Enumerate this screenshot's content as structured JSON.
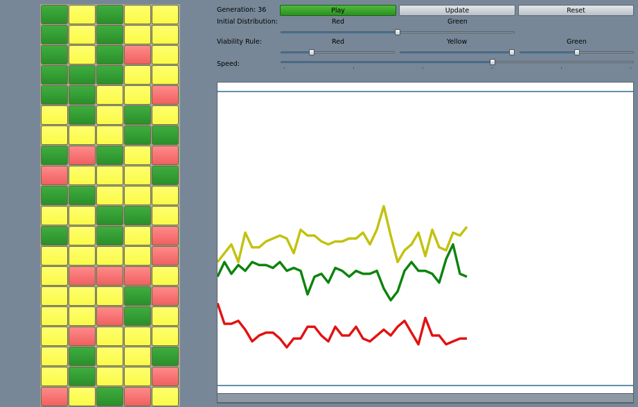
{
  "controls": {
    "generation_label": "Generation: 36",
    "play_label": "Play",
    "update_label": "Update",
    "reset_label": "Reset",
    "initial_distribution_label": "Initial Distribution:",
    "initial_distribution_red": "Red",
    "initial_distribution_green": "Green",
    "viability_rule_label": "Viability Rule:",
    "viability_red": "Red",
    "viability_yellow": "Yellow",
    "viability_green": "Green",
    "speed_label": "Speed:"
  },
  "sliders": {
    "initial_distribution": 0.5,
    "viability_red": 0.27,
    "viability_yellow": 0.98,
    "viability_green": 0.5,
    "speed": 0.6
  },
  "colors": {
    "cell_green": "#2f9a2f",
    "cell_yellow": "#ffff55",
    "cell_red": "#f77070",
    "series_yellow": "#c2c20f",
    "series_green": "#0d830d",
    "series_red": "#e21212",
    "chart_lines": "#2b6b8c",
    "slider_fill": "#2e7fc1"
  },
  "grid": {
    "rows": [
      [
        "g",
        "y",
        "g",
        "y",
        "y"
      ],
      [
        "g",
        "y",
        "g",
        "y",
        "y"
      ],
      [
        "g",
        "y",
        "g",
        "r",
        "y"
      ],
      [
        "g",
        "g",
        "g",
        "y",
        "y"
      ],
      [
        "g",
        "g",
        "y",
        "y",
        "r"
      ],
      [
        "y",
        "g",
        "y",
        "g",
        "y"
      ],
      [
        "y",
        "y",
        "y",
        "g",
        "g"
      ],
      [
        "g",
        "r",
        "g",
        "y",
        "r"
      ],
      [
        "r",
        "y",
        "y",
        "y",
        "g"
      ],
      [
        "g",
        "g",
        "y",
        "y",
        "y"
      ],
      [
        "y",
        "y",
        "g",
        "g",
        "y"
      ],
      [
        "g",
        "y",
        "g",
        "y",
        "r"
      ],
      [
        "y",
        "y",
        "y",
        "y",
        "r"
      ],
      [
        "y",
        "r",
        "r",
        "r",
        "y"
      ],
      [
        "y",
        "y",
        "y",
        "g",
        "r"
      ],
      [
        "y",
        "y",
        "r",
        "g",
        "y"
      ],
      [
        "y",
        "r",
        "y",
        "y",
        "y"
      ],
      [
        "y",
        "g",
        "y",
        "y",
        "g"
      ],
      [
        "y",
        "g",
        "y",
        "y",
        "r"
      ],
      [
        "r",
        "y",
        "g",
        "r",
        "y"
      ]
    ]
  },
  "chart_data": {
    "type": "line",
    "x": [
      0,
      1,
      2,
      3,
      4,
      5,
      6,
      7,
      8,
      9,
      10,
      11,
      12,
      13,
      14,
      15,
      16,
      17,
      18,
      19,
      20,
      21,
      22,
      23,
      24,
      25,
      26,
      27,
      28,
      29,
      30,
      31,
      32,
      33,
      34,
      35,
      36
    ],
    "series": [
      {
        "color": "yellow",
        "values": [
          42,
          45,
          48,
          42,
          52,
          47,
          47,
          49,
          50,
          51,
          50,
          45,
          53,
          51,
          51,
          49,
          48,
          49,
          49,
          50,
          50,
          52,
          48,
          53,
          61,
          51,
          42,
          46,
          48,
          52,
          44,
          53,
          47,
          46,
          52,
          51,
          54
        ]
      },
      {
        "color": "green",
        "values": [
          37,
          42,
          38,
          41,
          39,
          42,
          41,
          41,
          40,
          42,
          39,
          40,
          39,
          31,
          37,
          38,
          35,
          40,
          39,
          37,
          39,
          38,
          38,
          39,
          33,
          29,
          32,
          39,
          42,
          39,
          39,
          38,
          35,
          43,
          48,
          38,
          37
        ]
      },
      {
        "color": "red",
        "values": [
          28,
          21,
          21,
          22,
          19,
          15,
          17,
          18,
          18,
          16,
          13,
          16,
          16,
          20,
          20,
          17,
          15,
          20,
          17,
          17,
          20,
          16,
          15,
          17,
          19,
          17,
          20,
          22,
          18,
          14,
          23,
          17,
          17,
          14,
          15,
          16,
          16
        ]
      }
    ],
    "xlim": [
      0,
      60
    ],
    "ylim": [
      0,
      100
    ]
  }
}
